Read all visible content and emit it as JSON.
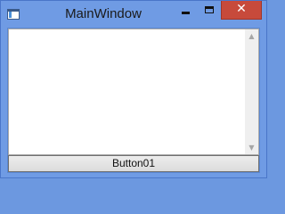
{
  "window": {
    "title": "MainWindow",
    "close_glyph": "✕"
  },
  "icons": {
    "app": "app-window-icon",
    "minimize": "minimize-icon",
    "maximize": "maximize-icon",
    "close": "close-icon",
    "scroll_up": "chevron-up-icon",
    "scroll_down": "chevron-down-icon"
  },
  "list": {
    "items": []
  },
  "scrollbar": {
    "up_glyph": "▲",
    "down_glyph": "▼"
  },
  "button01": {
    "label": "Button01"
  },
  "colors": {
    "frame": "#6f9be4",
    "close_button": "#c74a3b",
    "client": "#ffffff"
  }
}
